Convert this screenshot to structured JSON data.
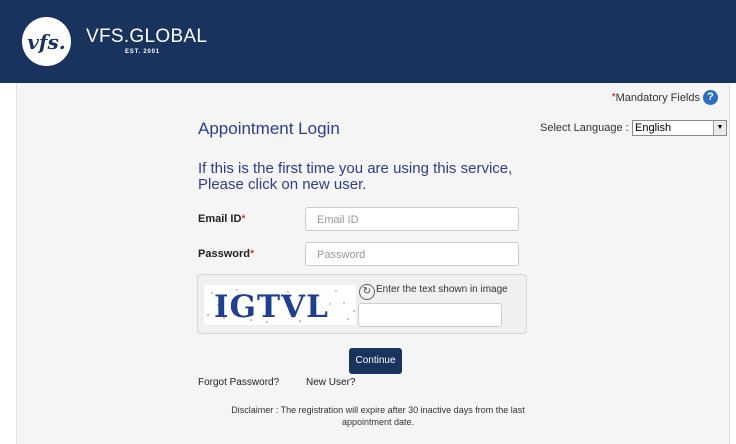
{
  "header": {
    "logo_text": "vfs.",
    "brand": "VFS.GLOBAL",
    "est": "EST. 2001"
  },
  "mandatory": {
    "star": "*",
    "label": "Mandatory Fields",
    "help_glyph": "?"
  },
  "title": "Appointment Login",
  "language": {
    "label": "Select Language :",
    "selected": "English"
  },
  "info_line1": "If this is the first time you are using this service,",
  "info_line2": "Please click on new user.",
  "email": {
    "label": "Email ID",
    "required": "*",
    "placeholder": "Email ID"
  },
  "password": {
    "label": "Password",
    "required": "*",
    "placeholder": "Password"
  },
  "captcha": {
    "image_text": "IGTVL",
    "prompt": "Enter the text shown in image"
  },
  "continue_label": "Continue",
  "forgot_password": "Forgot Password?",
  "new_user": "New User?",
  "disclaimer_line1": "Disclaimer : The registration will expire after 30 inactive days from the last",
  "disclaimer_line2": "appointment date.",
  "colors": {
    "brand_navy": "#17335e",
    "heading_blue": "#2c3e8c",
    "required_red": "#c00000"
  },
  "icons": {
    "help": "help-icon",
    "refresh": "refresh-icon",
    "dropdown": "chevron-down-icon"
  }
}
